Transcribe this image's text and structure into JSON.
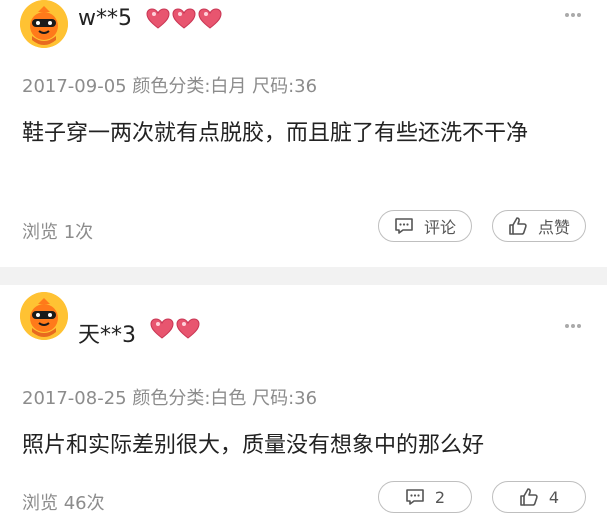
{
  "reviews": [
    {
      "username": "w**5",
      "meta": "2017-09-05 颜色分类:白月 尺码:36",
      "content": "鞋子穿一两次就有点脱胶，而且脏了有些还洗不干净",
      "views": "浏览 1次",
      "comment_label": "评论",
      "like_label": "点赞"
    },
    {
      "username": "天**3",
      "meta": "2017-08-25 颜色分类:白色 尺码:36",
      "content": "照片和实际差别很大，质量没有想象中的那么好",
      "views": "浏览 46次",
      "comment_label": "2",
      "like_label": "4"
    }
  ],
  "colors": {
    "accent_heart": "#e8556f",
    "avatar_bg": "#ffc233",
    "muted_text": "#8c8c8c",
    "separator": "#f2f2f2"
  },
  "icons": [
    "avatar-mascot",
    "heart-badge",
    "more-dots-icon",
    "comment-icon",
    "thumbs-up-icon"
  ]
}
